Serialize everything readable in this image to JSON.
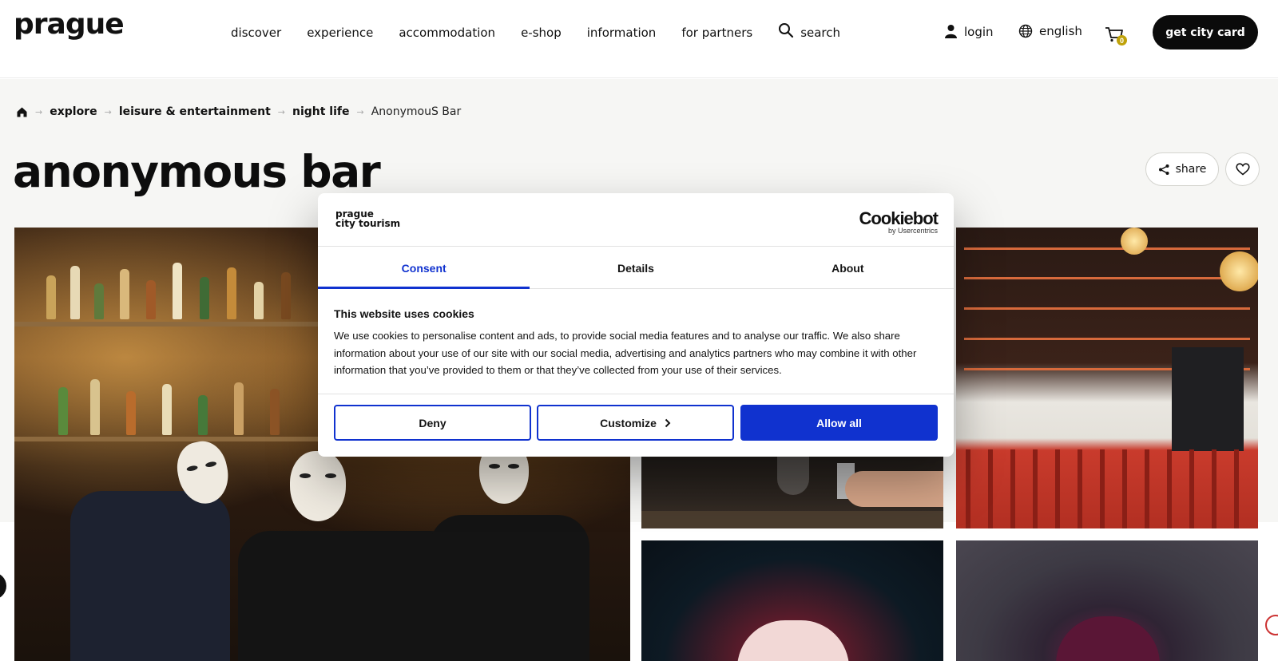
{
  "header": {
    "logo": "prague",
    "nav": [
      "discover",
      "experience",
      "accommodation",
      "e-shop",
      "information",
      "for partners"
    ],
    "search_label": "search",
    "login_label": "login",
    "language_label": "english",
    "cart_count": "0",
    "cta_label": "get city card"
  },
  "breadcrumb": {
    "items": [
      "explore",
      "leisure & entertainment",
      "night life"
    ],
    "current": "AnonymouS Bar"
  },
  "page": {
    "title": "anonymous bar",
    "share_label": "share"
  },
  "cookie_dialog": {
    "brand_line1": "prague",
    "brand_line2": "city tourism",
    "vendor_name": "Cookiebot",
    "vendor_sub": "by Usercentrics",
    "tabs": [
      "Consent",
      "Details",
      "About"
    ],
    "active_tab": "Consent",
    "heading": "This website uses cookies",
    "body": "We use cookies to personalise content and ads, to provide social media features and to analyse our traffic. We also share information about your use of our site with our social media, advertising and analytics partners who may combine it with other information that you’ve provided to them or that they’ve collected from your use of their services.",
    "buttons": {
      "deny": "Deny",
      "customize": "Customize",
      "allow_all": "Allow all"
    },
    "accent_color": "#1032cf"
  },
  "icons": {
    "home": "home-icon",
    "search": "search-icon",
    "user": "user-icon",
    "globe": "globe-icon",
    "cart": "cart-icon",
    "share": "share-icon",
    "heart": "heart-icon",
    "chevron": "chevron-right-icon"
  }
}
